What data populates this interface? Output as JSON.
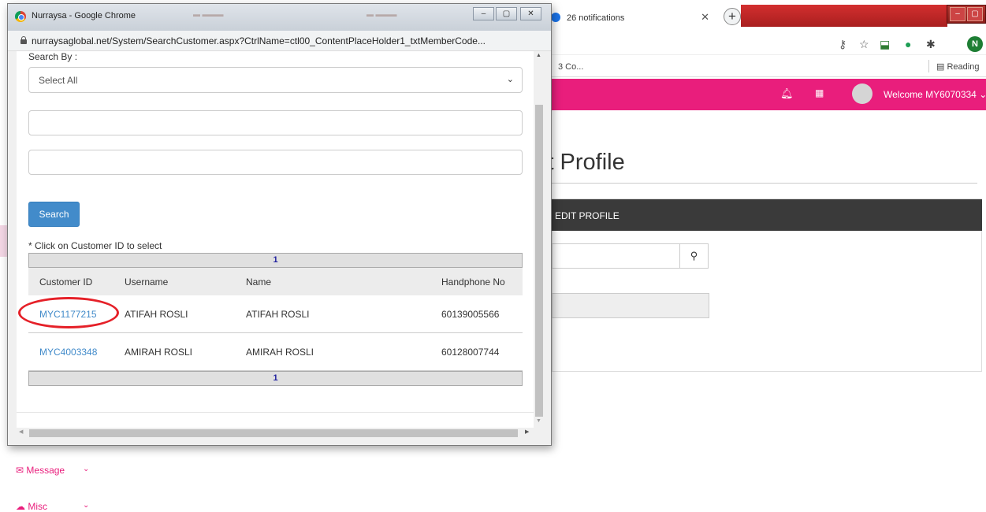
{
  "background_browser": {
    "tab_label": "26 notifications",
    "bookmark_partial": "3 Co...",
    "reading_list": "Reading",
    "profile_initial": "N",
    "welcome_text": "Welcome MY6070334",
    "page_title_partial": "it Profile",
    "panel_heading": "EDIT PROFILE",
    "sidebar": {
      "message_label": "Message",
      "misc_label": "Misc"
    },
    "accent_color": "#e91e7c"
  },
  "popup": {
    "window_title": "Nurraysa - Google Chrome",
    "url": "nurraysaglobal.net/System/SearchCustomer.aspx?CtrlName=ctl00_ContentPlaceHolder1_txtMemberCode...",
    "search_by_label": "Search By :",
    "search_by_value": "Select All",
    "text_field_1": "",
    "text_field_2": "",
    "search_button": "Search",
    "hint": "* Click on Customer ID to select",
    "results": {
      "page_top": "1",
      "page_bottom": "1",
      "columns": [
        "Customer ID",
        "Username",
        "Name",
        "Handphone No"
      ],
      "rows": [
        {
          "customer_id": "MYC1177215",
          "username": "ATIFAH ROSLI",
          "name": "ATIFAH ROSLI",
          "phone": "60139005566"
        },
        {
          "customer_id": "MYC4003348",
          "username": "AMIRAH ROSLI",
          "name": "AMIRAH ROSLI",
          "phone": "60128007744"
        }
      ]
    },
    "link_color": "#428bca",
    "button_color": "#428bca"
  },
  "annotation": {
    "highlight_color": "#e52028"
  }
}
